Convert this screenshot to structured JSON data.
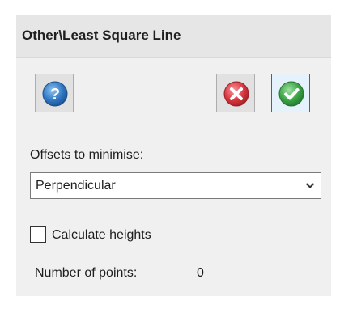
{
  "panel": {
    "title": "Other\\Least Square Line"
  },
  "toolbar": {
    "help_icon": "help-icon",
    "cancel_icon": "cancel-icon",
    "ok_icon": "ok-icon"
  },
  "offsets": {
    "label": "Offsets to minimise:",
    "selected": "Perpendicular",
    "arrow_icon": "chevron-down-icon"
  },
  "calculate_heights": {
    "label": "Calculate heights",
    "checked": false
  },
  "points": {
    "label": "Number of points:",
    "value": "0"
  },
  "colors": {
    "help": "#2f78c4",
    "cancel": "#d9363e",
    "ok": "#3aa545",
    "focus_border": "#0078d7"
  }
}
